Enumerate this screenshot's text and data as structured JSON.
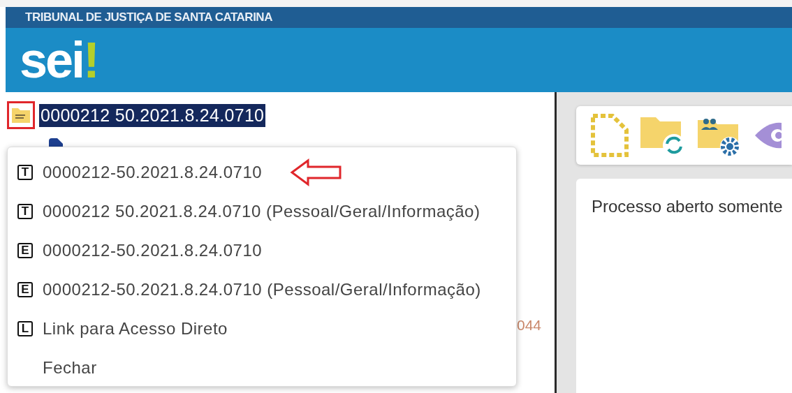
{
  "header": {
    "org": "TRIBUNAL DE JUSTIÇA DE SANTA CATARINA",
    "logo": "sei",
    "logo_mark": "!"
  },
  "process": {
    "number": "0000212 50.2021.8.24.0710",
    "selected": true
  },
  "tree": [
    {
      "text": "044"
    }
  ],
  "menu": [
    {
      "key": "T",
      "label": "0000212-50.2021.8.24.0710",
      "pointed": true
    },
    {
      "key": "T",
      "label": "0000212 50.2021.8.24.0710 (Pessoal/Geral/Informação)",
      "pointed": false
    },
    {
      "key": "E",
      "label": "0000212-50.2021.8.24.0710",
      "pointed": false
    },
    {
      "key": "E",
      "label": "0000212-50.2021.8.24.0710 (Pessoal/Geral/Informação)",
      "pointed": false
    },
    {
      "key": "L",
      "label": "Link para Acesso Direto",
      "pointed": false
    },
    {
      "label": "Fechar",
      "pointed": false
    }
  ],
  "content": {
    "text": "Processo aberto somente"
  }
}
